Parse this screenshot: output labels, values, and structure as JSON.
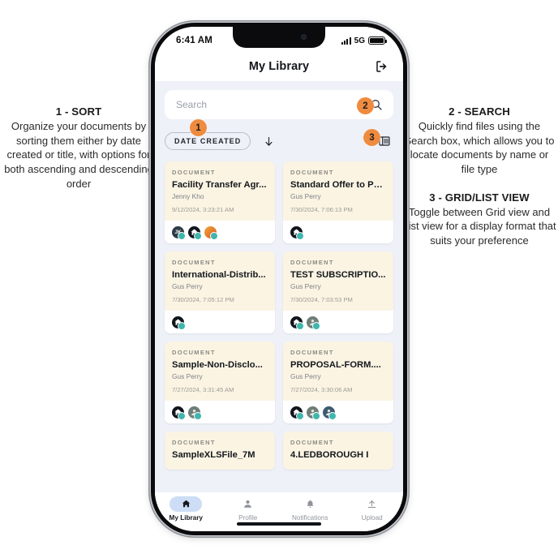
{
  "annotations": {
    "left": [
      {
        "title": "1 - SORT",
        "body": "Organize your documents by sorting them either by date created or title, with options for both ascending and descending order"
      }
    ],
    "right": [
      {
        "title": "2 - SEARCH",
        "body": "Quickly find files using the Search box, which allows you to locate documents by name or file type"
      },
      {
        "title": "3 - GRID/LIST VIEW",
        "body": "Toggle between Grid view and List view for a display format that suits your preference"
      }
    ]
  },
  "status_bar": {
    "time": "6:41 AM",
    "network": "5G",
    "signal_icon": "signal-bars-icon",
    "battery_icon": "battery-full-icon"
  },
  "header": {
    "title": "My Library",
    "logout_icon": "logout-icon"
  },
  "search": {
    "placeholder": "Search",
    "value": "",
    "icon": "search-icon"
  },
  "sort": {
    "chip_label": "DATE CREATED",
    "direction_icon": "arrow-down-icon"
  },
  "view": {
    "toggle_icon": "list-view-icon"
  },
  "callouts": {
    "one": "1",
    "two": "2",
    "three": "3",
    "color": "#ef8b3f"
  },
  "documents": [
    {
      "kind": "DOCUMENT",
      "title": "Facility Transfer Agr...",
      "owner": "Jenny Kho",
      "date": "9/12/2024, 3:23:21 AM",
      "avatars": [
        {
          "type": "initials",
          "label": "JK",
          "style": "av-dark"
        },
        {
          "type": "home",
          "label": "",
          "style": "av-home"
        },
        {
          "type": "flag",
          "label": "",
          "style": "av-orange"
        }
      ]
    },
    {
      "kind": "DOCUMENT",
      "title": "Standard Offer to Pu...",
      "owner": "Gus Perry",
      "date": "7/30/2024, 7:06:13 PM",
      "avatars": [
        {
          "type": "home",
          "label": "",
          "style": "av-home"
        }
      ]
    },
    {
      "kind": "DOCUMENT",
      "title": "International-Distrib...",
      "owner": "Gus Perry",
      "date": "7/30/2024, 7:05:12 PM",
      "avatars": [
        {
          "type": "home",
          "label": "",
          "style": "av-home"
        }
      ]
    },
    {
      "kind": "DOCUMENT",
      "title": "TEST SUBSCRIPTIO...",
      "owner": "Gus Perry",
      "date": "7/30/2024, 7:03:53 PM",
      "avatars": [
        {
          "type": "home",
          "label": "",
          "style": "av-home"
        },
        {
          "type": "person",
          "label": "",
          "style": "av-person"
        }
      ]
    },
    {
      "kind": "DOCUMENT",
      "title": "Sample-Non-Disclo...",
      "owner": "Gus Perry",
      "date": "7/27/2024, 3:31:45 AM",
      "avatars": [
        {
          "type": "home",
          "label": "",
          "style": "av-home"
        },
        {
          "type": "person",
          "label": "",
          "style": "av-person"
        }
      ]
    },
    {
      "kind": "DOCUMENT",
      "title": "PROPOSAL-FORM....",
      "owner": "Gus Perry",
      "date": "7/27/2024, 3:30:06 AM",
      "avatars": [
        {
          "type": "home",
          "label": "",
          "style": "av-home"
        },
        {
          "type": "person",
          "label": "",
          "style": "av-person"
        },
        {
          "type": "person",
          "label": "",
          "style": "av-blue"
        }
      ]
    },
    {
      "kind": "DOCUMENT",
      "title": "SampleXLSFile_7M",
      "owner": "",
      "date": "",
      "avatars": []
    },
    {
      "kind": "DOCUMENT",
      "title": "4.LEDBOROUGH I",
      "owner": "",
      "date": "",
      "avatars": []
    }
  ],
  "bottom_nav": [
    {
      "label": "My Library",
      "icon": "home-icon",
      "active": true
    },
    {
      "label": "Profile",
      "icon": "person-icon",
      "active": false
    },
    {
      "label": "Notifications",
      "icon": "bell-icon",
      "active": false
    },
    {
      "label": "Upload",
      "icon": "upload-icon",
      "active": false
    }
  ]
}
